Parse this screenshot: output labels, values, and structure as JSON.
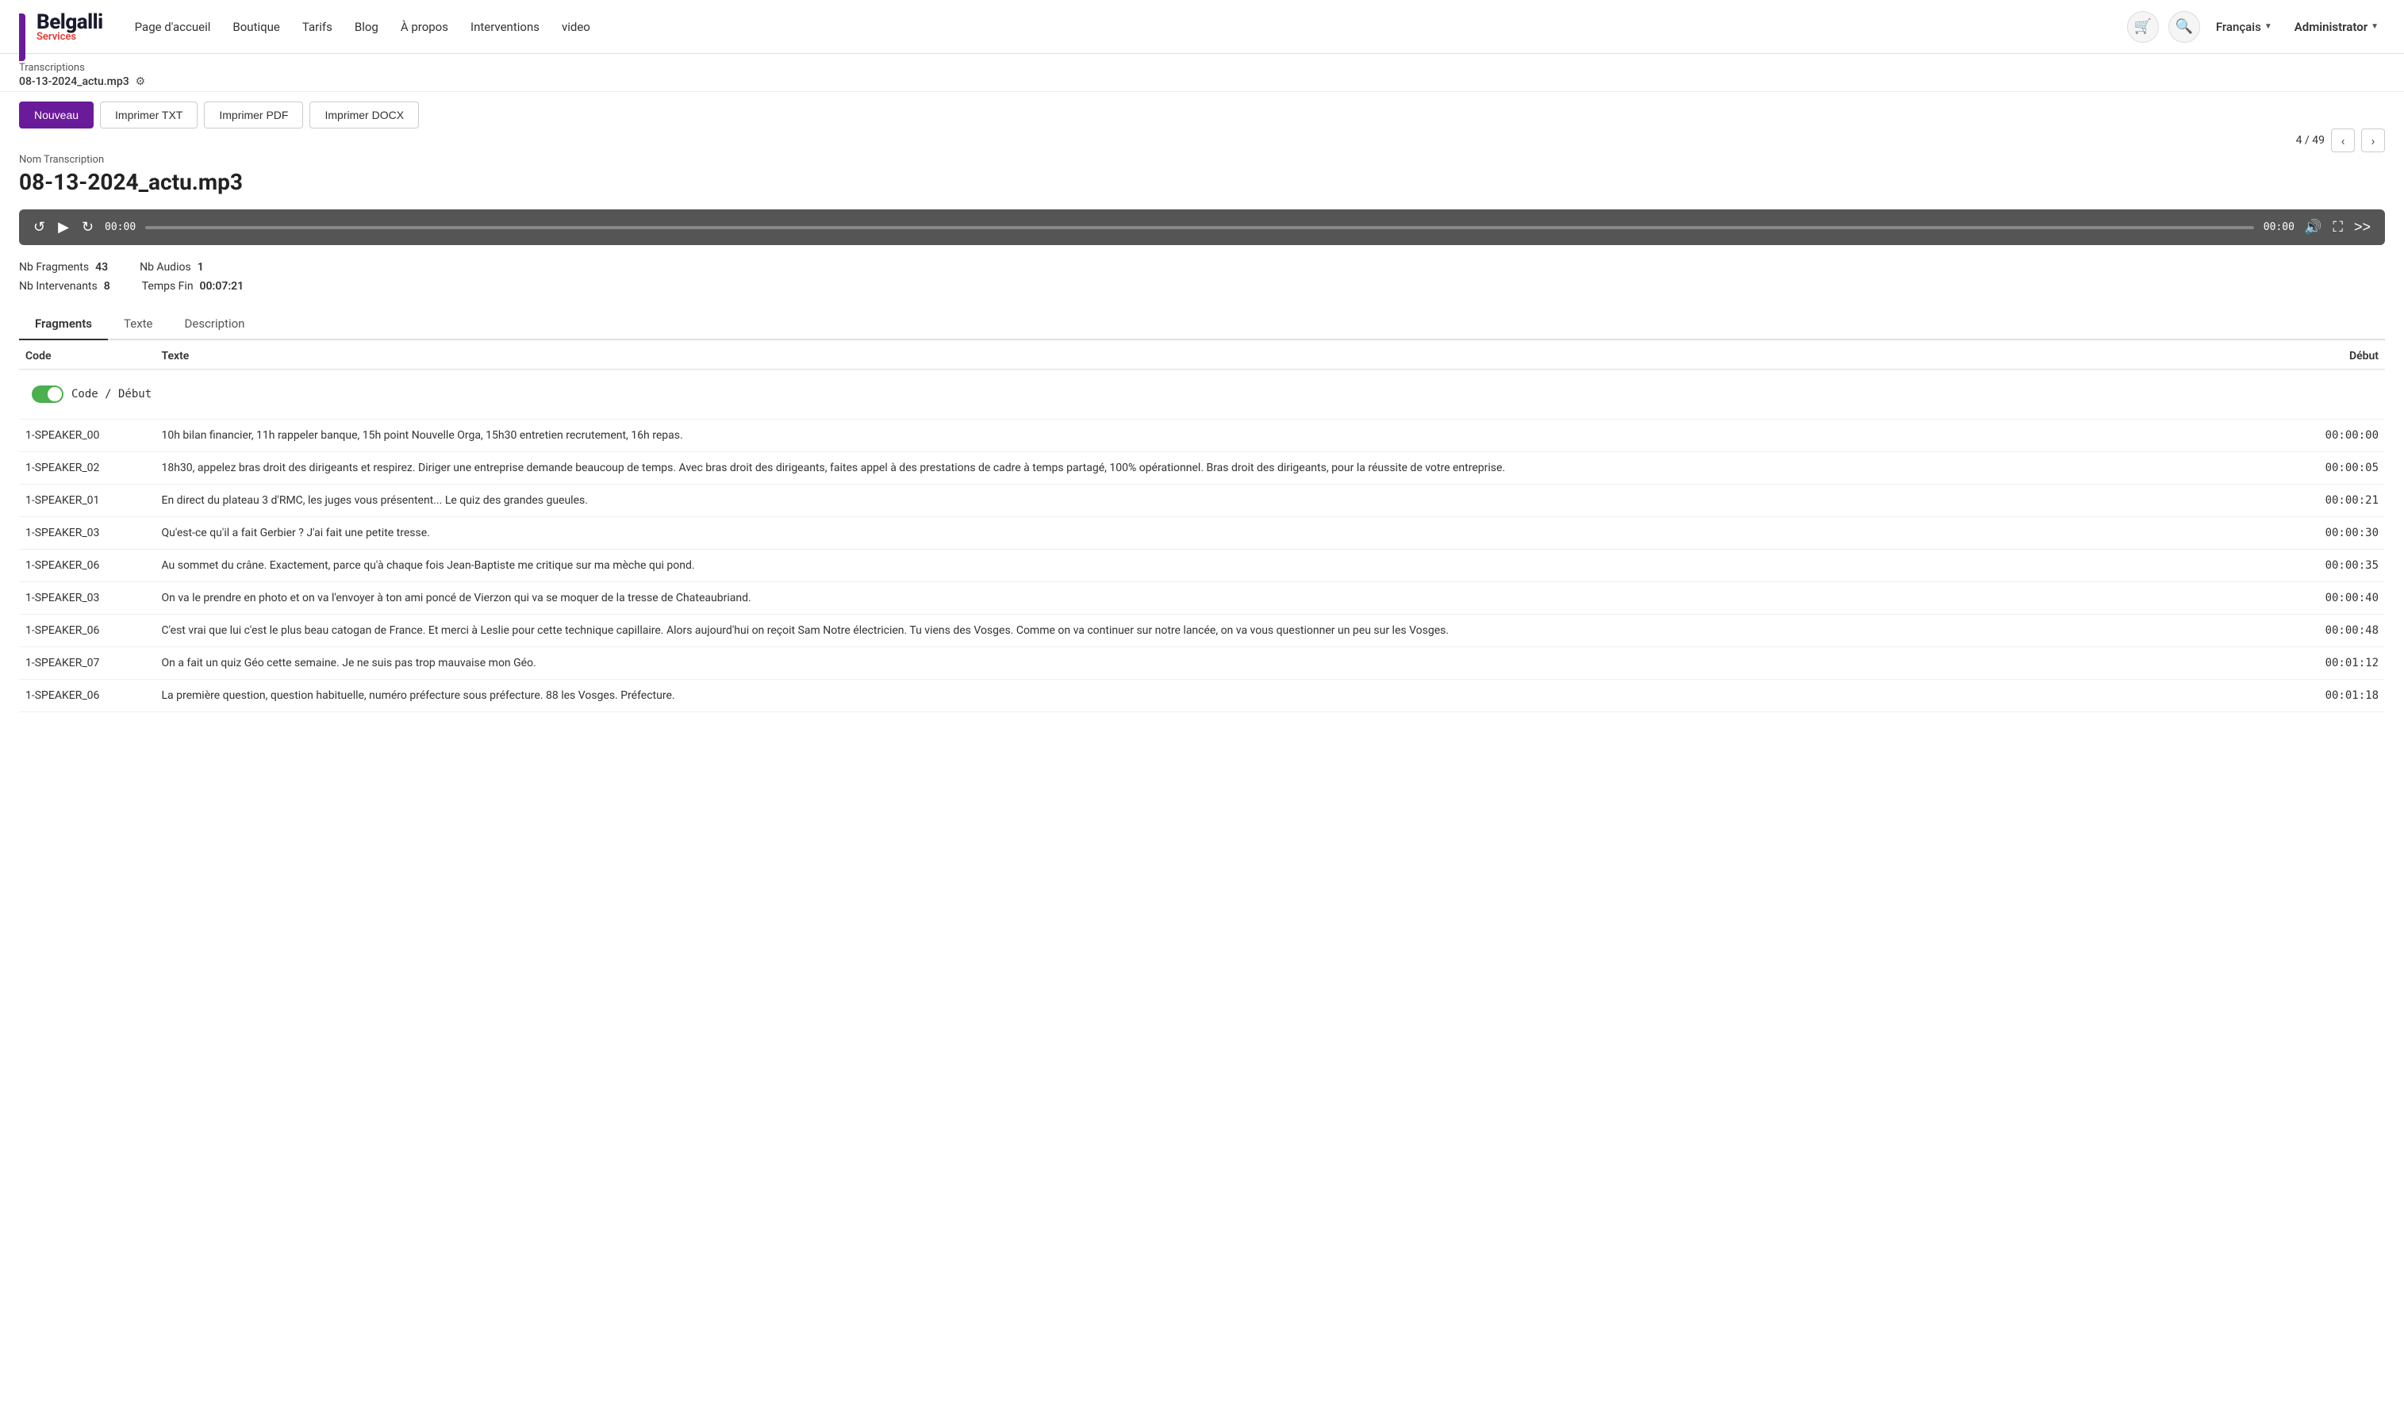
{
  "nav": {
    "logo_belgalli": "Belgalli",
    "logo_services": "Services",
    "links": [
      {
        "label": "Page d'accueil",
        "name": "nav-home"
      },
      {
        "label": "Boutique",
        "name": "nav-boutique"
      },
      {
        "label": "Tarifs",
        "name": "nav-tarifs"
      },
      {
        "label": "Blog",
        "name": "nav-blog"
      },
      {
        "label": "À propos",
        "name": "nav-apropos"
      },
      {
        "label": "Interventions",
        "name": "nav-interventions"
      },
      {
        "label": "video",
        "name": "nav-video"
      }
    ],
    "lang_label": "Français",
    "admin_label": "Administrator"
  },
  "breadcrumb": {
    "section": "Transcriptions",
    "filename": "08-13-2024_actu.mp3"
  },
  "pagination": {
    "current": "4",
    "total": "49",
    "display": "4 / 49"
  },
  "toolbar": {
    "btn_nouveau": "Nouveau",
    "btn_txt": "Imprimer TXT",
    "btn_pdf": "Imprimer PDF",
    "btn_docx": "Imprimer DOCX"
  },
  "transcription": {
    "label": "Nom Transcription",
    "title": "08-13-2024_actu.mp3",
    "audio_time_start": "00:00",
    "audio_time_end": "00:00",
    "nb_fragments_label": "Nb Fragments",
    "nb_fragments_value": "43",
    "nb_audios_label": "Nb Audios",
    "nb_audios_value": "1",
    "nb_intervenants_label": "Nb Intervenants",
    "nb_intervenants_value": "8",
    "temps_fin_label": "Temps Fin",
    "temps_fin_value": "00:07:21"
  },
  "tabs": [
    {
      "label": "Fragments",
      "active": true
    },
    {
      "label": "Texte",
      "active": false
    },
    {
      "label": "Description",
      "active": false
    }
  ],
  "table": {
    "col_code": "Code",
    "col_texte": "Texte",
    "col_debut": "Début",
    "toggle_label": "Code / Début",
    "rows": [
      {
        "code": "1-SPEAKER_00",
        "texte": "10h bilan financier, 11h rappeler banque, 15h point Nouvelle Orga, 15h30 entretien recrutement, 16h repas.",
        "debut": "00:00:00"
      },
      {
        "code": "1-SPEAKER_02",
        "texte": "18h30, appelez bras droit des dirigeants et respirez. Diriger une entreprise demande beaucoup de temps. Avec bras droit des dirigeants, faites appel à des prestations de cadre à temps partagé, 100% opérationnel. Bras droit des dirigeants, pour la réussite de votre entreprise.",
        "debut": "00:00:05"
      },
      {
        "code": "1-SPEAKER_01",
        "texte": "En direct du plateau 3 d'RMC, les juges vous présentent... Le quiz des grandes gueules.",
        "debut": "00:00:21"
      },
      {
        "code": "1-SPEAKER_03",
        "texte": "Qu'est-ce qu'il a fait Gerbier ? J'ai fait une petite tresse.",
        "debut": "00:00:30"
      },
      {
        "code": "1-SPEAKER_06",
        "texte": "Au sommet du crâne. Exactement, parce qu'à chaque fois Jean-Baptiste me critique sur ma mèche qui pond.",
        "debut": "00:00:35"
      },
      {
        "code": "1-SPEAKER_03",
        "texte": "On va le prendre en photo et on va l'envoyer à ton ami poncé de Vierzon qui va se moquer de la tresse de Chateaubriand.",
        "debut": "00:00:40"
      },
      {
        "code": "1-SPEAKER_06",
        "texte": "C'est vrai que lui c'est le plus beau catogan de France. Et merci à Leslie pour cette technique capillaire. Alors aujourd'hui on reçoit Sam Notre électricien. Tu viens des Vosges. Comme on va continuer sur notre lancée, on va vous questionner un peu sur les Vosges.",
        "debut": "00:00:48"
      },
      {
        "code": "1-SPEAKER_07",
        "texte": "On a fait un quiz Géo cette semaine. Je ne suis pas trop mauvaise mon Géo.",
        "debut": "00:01:12"
      },
      {
        "code": "1-SPEAKER_06",
        "texte": "La première question, question habituelle, numéro préfecture sous préfecture. 88 les Vosges. Préfecture.",
        "debut": "00:01:18"
      }
    ]
  }
}
